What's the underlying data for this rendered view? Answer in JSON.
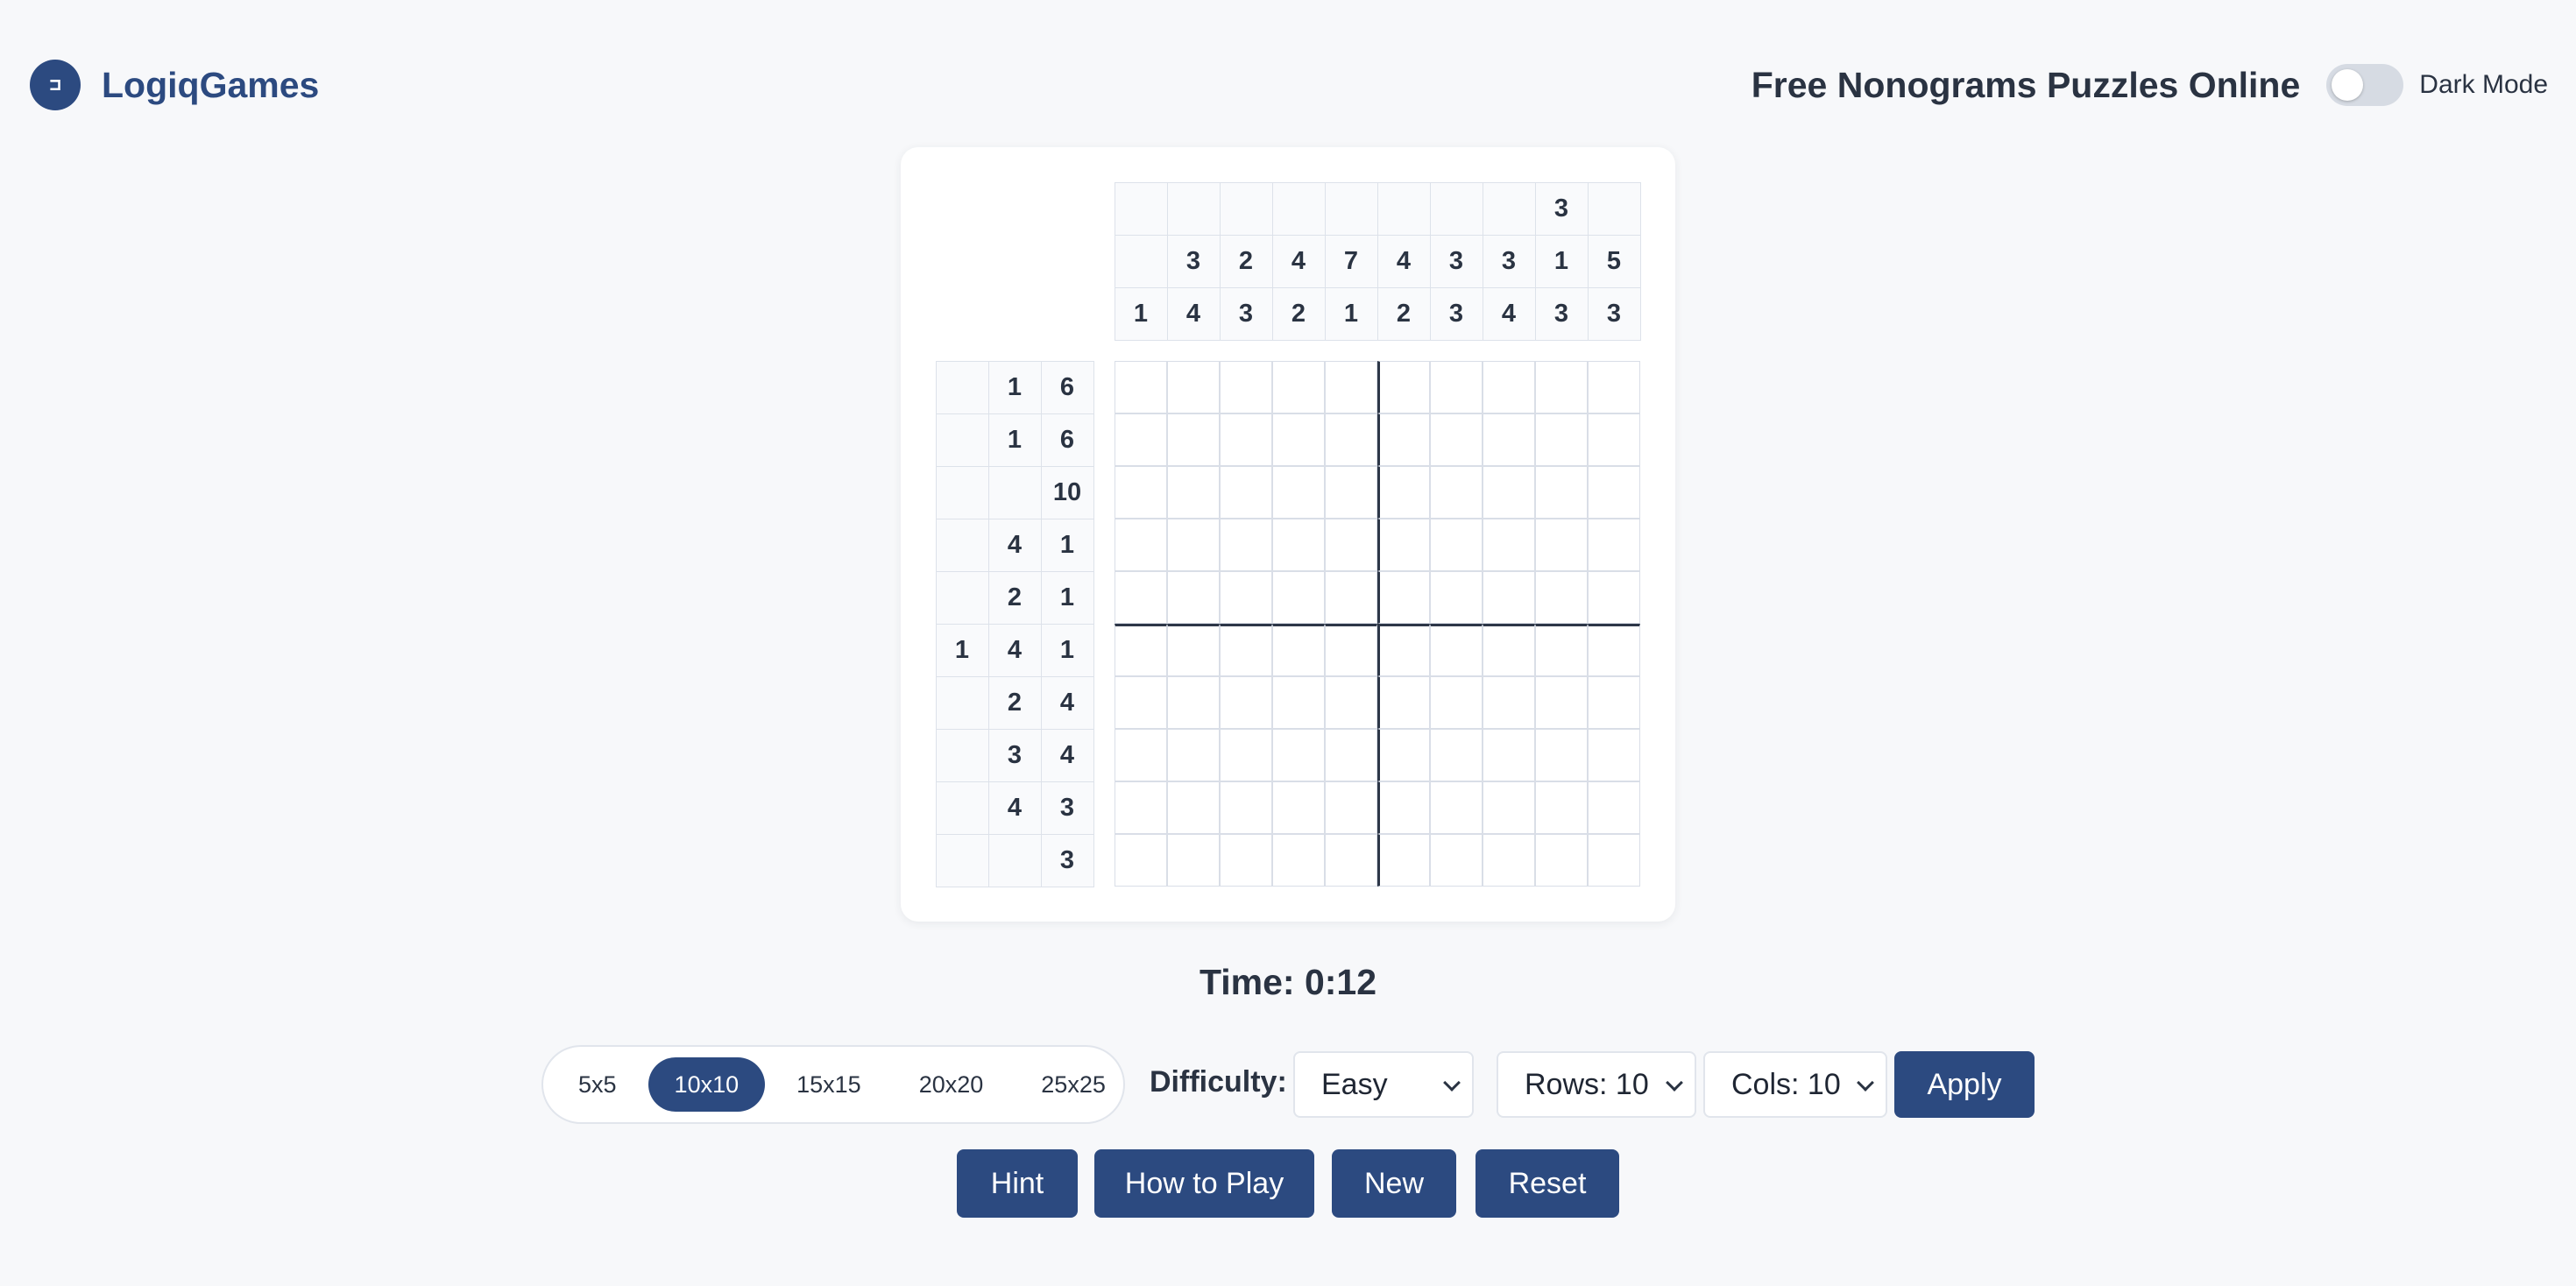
{
  "header": {
    "logo_glyph": "⊐",
    "brand": "LogiqGames",
    "title": "Free Nonograms Puzzles Online",
    "dark_mode_label": "Dark Mode",
    "dark_mode_on": false
  },
  "puzzle": {
    "column_clues": [
      [
        "",
        "",
        "1"
      ],
      [
        "",
        "3",
        "4"
      ],
      [
        "",
        "2",
        "3"
      ],
      [
        "",
        "4",
        "2"
      ],
      [
        "",
        "7",
        "1"
      ],
      [
        "",
        "4",
        "2"
      ],
      [
        "",
        "3",
        "3"
      ],
      [
        "",
        "3",
        "4"
      ],
      [
        "3",
        "1",
        "3"
      ],
      [
        "",
        "5",
        "3"
      ]
    ],
    "row_clues": [
      [
        "",
        "1",
        "6"
      ],
      [
        "",
        "1",
        "6"
      ],
      [
        "",
        "",
        "10"
      ],
      [
        "",
        "4",
        "1"
      ],
      [
        "",
        "2",
        "1"
      ],
      [
        "1",
        "4",
        "1"
      ],
      [
        "",
        "2",
        "4"
      ],
      [
        "",
        "3",
        "4"
      ],
      [
        "",
        "4",
        "3"
      ],
      [
        "",
        "",
        "3"
      ]
    ],
    "rows": 10,
    "cols": 10
  },
  "timer": {
    "text": "Time: 0:12"
  },
  "controls": {
    "sizes": [
      "5x5",
      "10x10",
      "15x15",
      "20x20",
      "25x25"
    ],
    "active_size": "10x10",
    "difficulty_label": "Difficulty:",
    "difficulty_value": "Easy",
    "rows_value": "Rows: 10",
    "cols_value": "Cols: 10",
    "apply_label": "Apply"
  },
  "actions": {
    "hint": "Hint",
    "how_to_play": "How to Play",
    "new": "New",
    "reset": "Reset"
  },
  "colors": {
    "accent": "#2c4a80",
    "background": "#f7f8fa",
    "text": "#2a3342"
  }
}
